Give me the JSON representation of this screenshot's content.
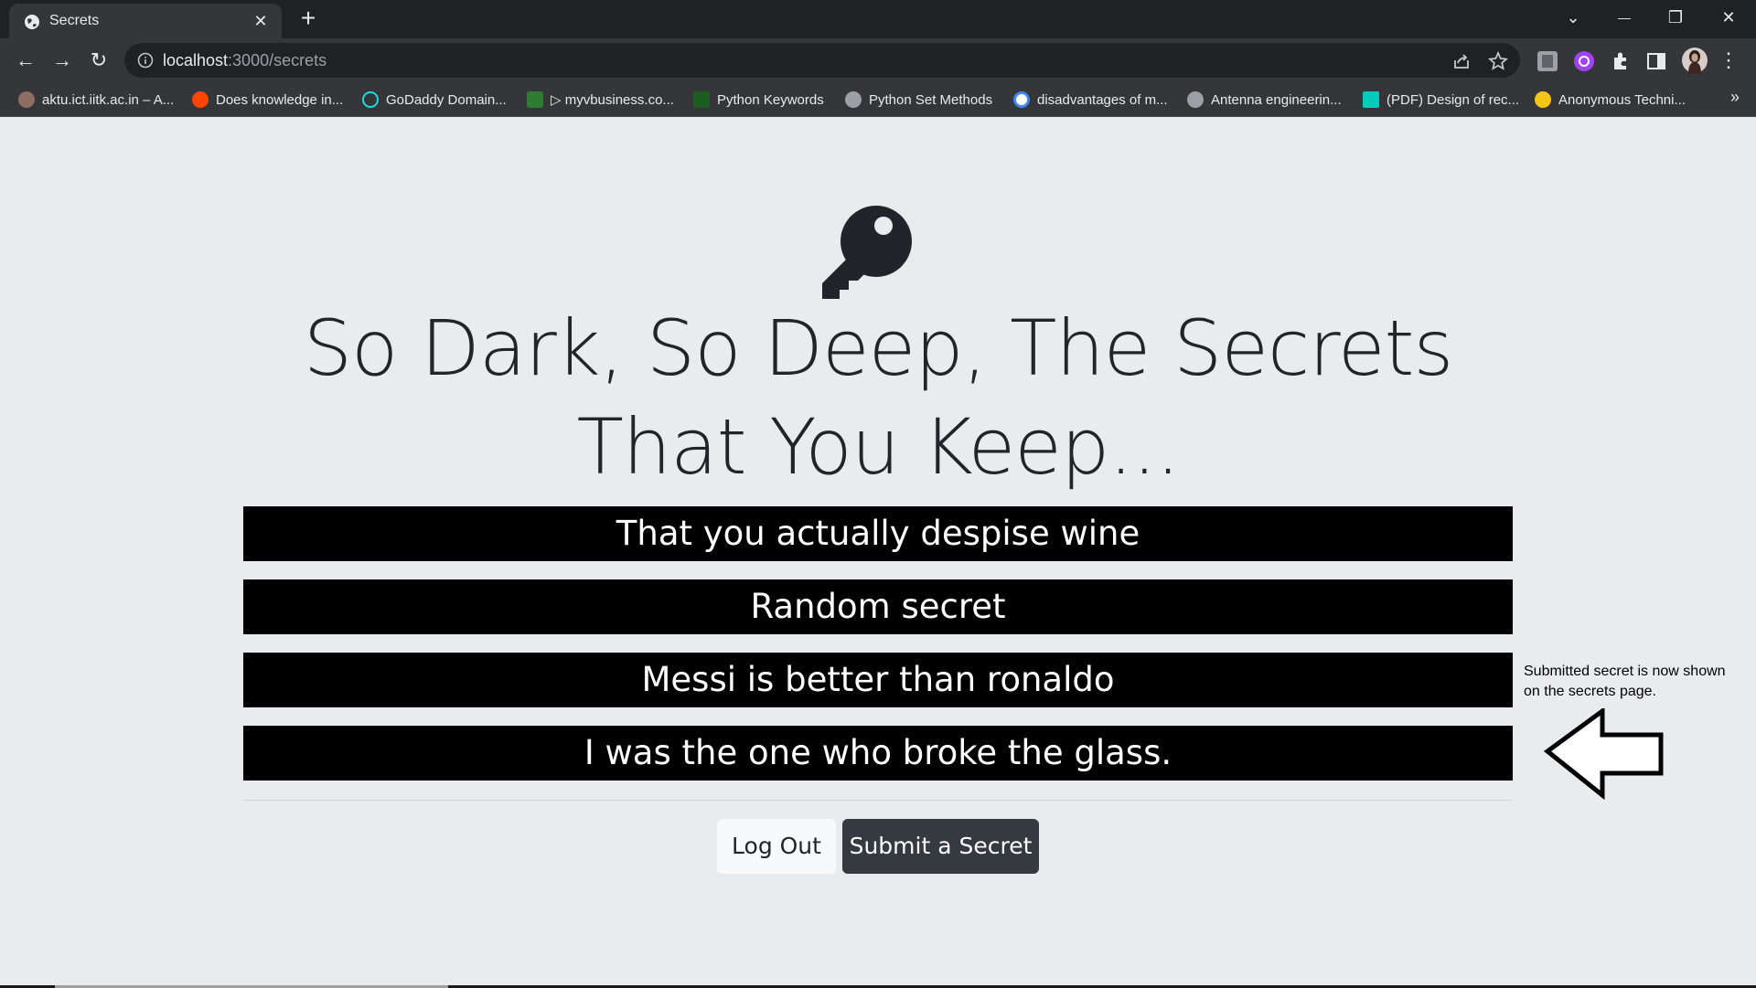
{
  "browser": {
    "tab_title": "Secrets",
    "tab_close": "✕",
    "new_tab": "+",
    "url_host": "localhost",
    "url_path": ":3000/secrets",
    "window_controls": {
      "tab_search": "⌄",
      "minimize": "—",
      "restore": "❐",
      "close": "✕"
    },
    "nav": {
      "back": "←",
      "forward": "→",
      "reload": "↻"
    },
    "bookmarks": [
      {
        "label": "aktu.ict.iitk.ac.in – A...",
        "color": "#8d6e63"
      },
      {
        "label": "Does knowledge in...",
        "color": "#ff4500"
      },
      {
        "label": "GoDaddy Domain...",
        "color": "#1bdbdb"
      },
      {
        "label": "▷ myvbusiness.co...",
        "color": "#2e7d32"
      },
      {
        "label": "Python Keywords",
        "color": "#1b5e20"
      },
      {
        "label": "Python Set Methods",
        "color": "#9aa0a6"
      },
      {
        "label": "disadvantages of m...",
        "color": "#4285f4"
      },
      {
        "label": "Antenna engineerin...",
        "color": "#9aa0a6"
      },
      {
        "label": "(PDF) Design of rec...",
        "color": "#00ccbb"
      },
      {
        "label": "Anonymous Techni...",
        "color": "#f5c518"
      }
    ],
    "bookmarks_more": "»"
  },
  "page": {
    "heading": "So Dark, So Deep, The Secrets That You Keep...",
    "secrets": [
      "That you actually despise wine",
      "Random secret",
      "Messi is better than ronaldo",
      "I was the one who broke the glass."
    ],
    "logout_label": "Log Out",
    "submit_label": "Submit a Secret",
    "annotation": "Submitted secret is now shown on the secrets page."
  },
  "colors": {
    "page_bg": "#e9ecef",
    "secret_bg": "#000000",
    "dark_button": "#343a40",
    "light_button": "#f8f9fa",
    "chrome_dark": "#202124",
    "chrome_toolbar": "#35363a"
  },
  "icons": [
    "globe-icon",
    "close-icon",
    "plus-icon",
    "back-arrow-icon",
    "forward-arrow-icon",
    "reload-icon",
    "info-icon",
    "share-icon",
    "star-icon",
    "extension-icon",
    "puzzle-icon",
    "sidebar-icon",
    "avatar",
    "menu-dots-icon",
    "key-icon",
    "arrow-left-outline-icon"
  ]
}
